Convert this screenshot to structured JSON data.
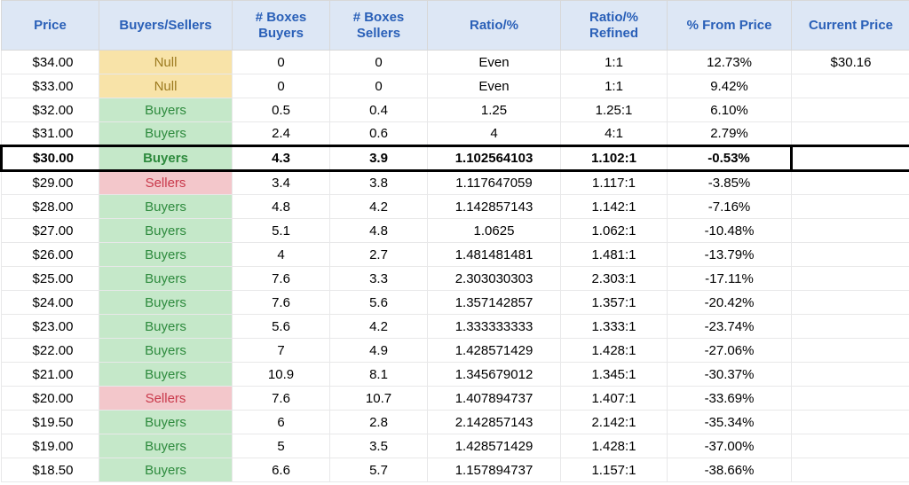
{
  "headers": {
    "price": "Price",
    "buyers_sellers": "Buyers/Sellers",
    "boxes_buyers": "# Boxes Buyers",
    "boxes_sellers": "# Boxes Sellers",
    "ratio": "Ratio/%",
    "ratio_refined": "Ratio/% Refined",
    "pct_from_price": "% From Price",
    "current_price": "Current Price"
  },
  "current_price": "$30.16",
  "rows": [
    {
      "price": "$34.00",
      "bs": "Null",
      "bs_type": "null",
      "bb": "0",
      "sb": "0",
      "ratio": "Even",
      "refined": "1:1",
      "pct": "12.73%",
      "highlight": false
    },
    {
      "price": "$33.00",
      "bs": "Null",
      "bs_type": "null",
      "bb": "0",
      "sb": "0",
      "ratio": "Even",
      "refined": "1:1",
      "pct": "9.42%",
      "highlight": false
    },
    {
      "price": "$32.00",
      "bs": "Buyers",
      "bs_type": "buyers",
      "bb": "0.5",
      "sb": "0.4",
      "ratio": "1.25",
      "refined": "1.25:1",
      "pct": "6.10%",
      "highlight": false
    },
    {
      "price": "$31.00",
      "bs": "Buyers",
      "bs_type": "buyers",
      "bb": "2.4",
      "sb": "0.6",
      "ratio": "4",
      "refined": "4:1",
      "pct": "2.79%",
      "highlight": false
    },
    {
      "price": "$30.00",
      "bs": "Buyers",
      "bs_type": "buyers",
      "bb": "4.3",
      "sb": "3.9",
      "ratio": "1.102564103",
      "refined": "1.102:1",
      "pct": "-0.53%",
      "highlight": true
    },
    {
      "price": "$29.00",
      "bs": "Sellers",
      "bs_type": "sellers",
      "bb": "3.4",
      "sb": "3.8",
      "ratio": "1.117647059",
      "refined": "1.117:1",
      "pct": "-3.85%",
      "highlight": false
    },
    {
      "price": "$28.00",
      "bs": "Buyers",
      "bs_type": "buyers",
      "bb": "4.8",
      "sb": "4.2",
      "ratio": "1.142857143",
      "refined": "1.142:1",
      "pct": "-7.16%",
      "highlight": false
    },
    {
      "price": "$27.00",
      "bs": "Buyers",
      "bs_type": "buyers",
      "bb": "5.1",
      "sb": "4.8",
      "ratio": "1.0625",
      "refined": "1.062:1",
      "pct": "-10.48%",
      "highlight": false
    },
    {
      "price": "$26.00",
      "bs": "Buyers",
      "bs_type": "buyers",
      "bb": "4",
      "sb": "2.7",
      "ratio": "1.481481481",
      "refined": "1.481:1",
      "pct": "-13.79%",
      "highlight": false
    },
    {
      "price": "$25.00",
      "bs": "Buyers",
      "bs_type": "buyers",
      "bb": "7.6",
      "sb": "3.3",
      "ratio": "2.303030303",
      "refined": "2.303:1",
      "pct": "-17.11%",
      "highlight": false
    },
    {
      "price": "$24.00",
      "bs": "Buyers",
      "bs_type": "buyers",
      "bb": "7.6",
      "sb": "5.6",
      "ratio": "1.357142857",
      "refined": "1.357:1",
      "pct": "-20.42%",
      "highlight": false
    },
    {
      "price": "$23.00",
      "bs": "Buyers",
      "bs_type": "buyers",
      "bb": "5.6",
      "sb": "4.2",
      "ratio": "1.333333333",
      "refined": "1.333:1",
      "pct": "-23.74%",
      "highlight": false
    },
    {
      "price": "$22.00",
      "bs": "Buyers",
      "bs_type": "buyers",
      "bb": "7",
      "sb": "4.9",
      "ratio": "1.428571429",
      "refined": "1.428:1",
      "pct": "-27.06%",
      "highlight": false
    },
    {
      "price": "$21.00",
      "bs": "Buyers",
      "bs_type": "buyers",
      "bb": "10.9",
      "sb": "8.1",
      "ratio": "1.345679012",
      "refined": "1.345:1",
      "pct": "-30.37%",
      "highlight": false
    },
    {
      "price": "$20.00",
      "bs": "Sellers",
      "bs_type": "sellers",
      "bb": "7.6",
      "sb": "10.7",
      "ratio": "1.407894737",
      "refined": "1.407:1",
      "pct": "-33.69%",
      "highlight": false
    },
    {
      "price": "$19.50",
      "bs": "Buyers",
      "bs_type": "buyers",
      "bb": "6",
      "sb": "2.8",
      "ratio": "2.142857143",
      "refined": "2.142:1",
      "pct": "-35.34%",
      "highlight": false
    },
    {
      "price": "$19.00",
      "bs": "Buyers",
      "bs_type": "buyers",
      "bb": "5",
      "sb": "3.5",
      "ratio": "1.428571429",
      "refined": "1.428:1",
      "pct": "-37.00%",
      "highlight": false
    },
    {
      "price": "$18.50",
      "bs": "Buyers",
      "bs_type": "buyers",
      "bb": "6.6",
      "sb": "5.7",
      "ratio": "1.157894737",
      "refined": "1.157:1",
      "pct": "-38.66%",
      "highlight": false
    }
  ]
}
